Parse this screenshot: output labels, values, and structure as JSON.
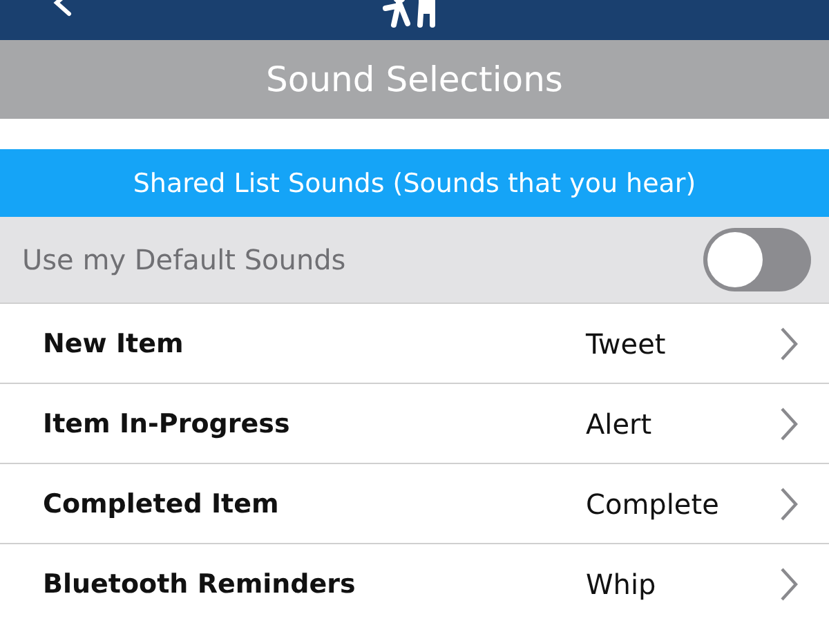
{
  "header": {
    "title": "Sound Selections"
  },
  "section": {
    "title": "Shared List Sounds (Sounds that you hear)"
  },
  "default_sounds": {
    "label": "Use my Default Sounds",
    "on": false
  },
  "rows": [
    {
      "label": "New Item",
      "value": "Tweet"
    },
    {
      "label": "Item In-Progress",
      "value": "Alert"
    },
    {
      "label": "Completed Item",
      "value": "Complete"
    },
    {
      "label": "Bluetooth Reminders",
      "value": "Whip"
    }
  ]
}
